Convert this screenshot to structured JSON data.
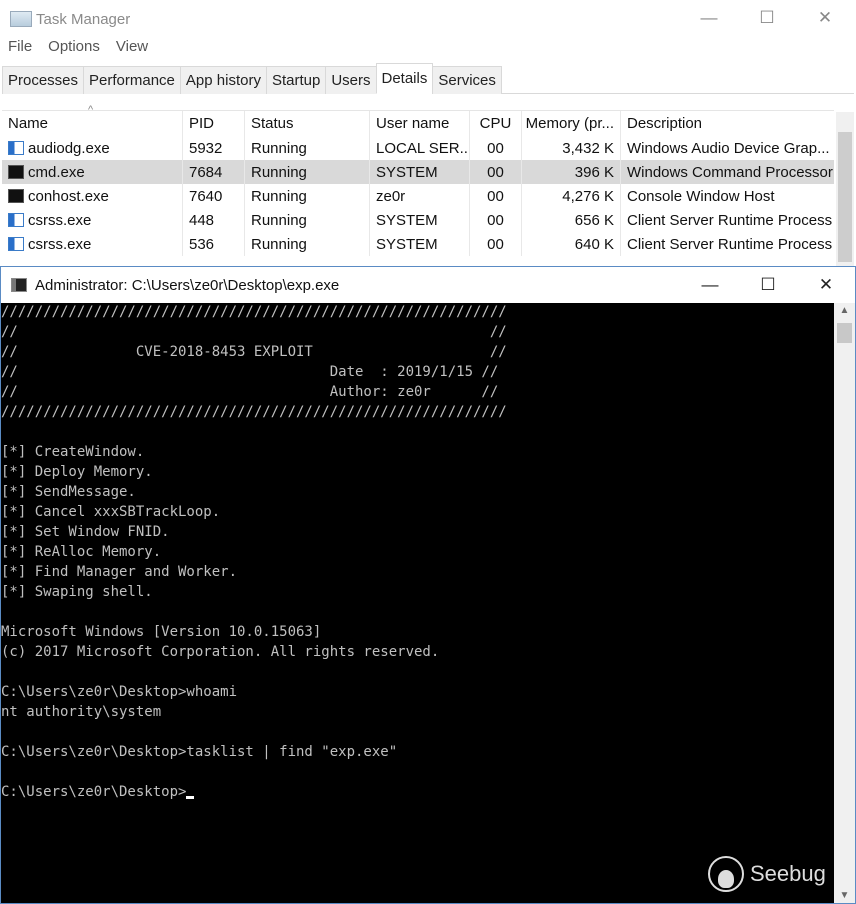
{
  "task_manager": {
    "title": "Task Manager",
    "window_controls": {
      "minimize": "—",
      "maximize": "☐",
      "close": "✕"
    },
    "menu": [
      "File",
      "Options",
      "View"
    ],
    "tabs": [
      "Processes",
      "Performance",
      "App history",
      "Startup",
      "Users",
      "Details",
      "Services"
    ],
    "active_tab": "Details",
    "sort_indicator": "^",
    "columns": [
      "Name",
      "PID",
      "Status",
      "User name",
      "CPU",
      "Memory (pr...",
      "Description"
    ],
    "rows": [
      {
        "name": "audiodg.exe",
        "icon": "window-app-icon",
        "pid": "5932",
        "status": "Running",
        "user": "LOCAL SER...",
        "cpu": "00",
        "memory": "3,432 K",
        "description": "Windows Audio Device Grap..."
      },
      {
        "name": "cmd.exe",
        "icon": "console-app-icon",
        "pid": "7684",
        "status": "Running",
        "user": "SYSTEM",
        "cpu": "00",
        "memory": "396 K",
        "description": "Windows Command Processor"
      },
      {
        "name": "conhost.exe",
        "icon": "console-app-icon",
        "pid": "7640",
        "status": "Running",
        "user": "ze0r",
        "cpu": "00",
        "memory": "4,276 K",
        "description": "Console Window Host"
      },
      {
        "name": "csrss.exe",
        "icon": "window-app-icon",
        "pid": "448",
        "status": "Running",
        "user": "SYSTEM",
        "cpu": "00",
        "memory": "656 K",
        "description": "Client Server Runtime Process"
      },
      {
        "name": "csrss.exe",
        "icon": "window-app-icon",
        "pid": "536",
        "status": "Running",
        "user": "SYSTEM",
        "cpu": "00",
        "memory": "640 K",
        "description": "Client Server Runtime Process"
      }
    ]
  },
  "console": {
    "title": "Administrator: C:\\Users\\ze0r\\Desktop\\exp.exe",
    "window_controls": {
      "minimize": "—",
      "maximize": "☐",
      "close": "✕"
    },
    "lines": [
      "////////////////////////////////////////////////////////////",
      "//                                                        //",
      "//              CVE-2018-8453 EXPLOIT                     //",
      "//                                     Date  : 2019/1/15 //",
      "//                                     Author: ze0r      //",
      "////////////////////////////////////////////////////////////",
      "",
      "[*] CreateWindow.",
      "[*] Deploy Memory.",
      "[*] SendMessage.",
      "[*] Cancel xxxSBTrackLoop.",
      "[*] Set Window FNID.",
      "[*] ReAlloc Memory.",
      "[*] Find Manager and Worker.",
      "[*] Swaping shell.",
      "",
      "Microsoft Windows [Version 10.0.15063]",
      "(c) 2017 Microsoft Corporation. All rights reserved.",
      "",
      "C:\\Users\\ze0r\\Desktop>whoami",
      "nt authority\\system",
      "",
      "C:\\Users\\ze0r\\Desktop>tasklist | find \"exp.exe\"",
      ""
    ],
    "prompt": "C:\\Users\\ze0r\\Desktop>"
  },
  "watermark": "Seebug"
}
